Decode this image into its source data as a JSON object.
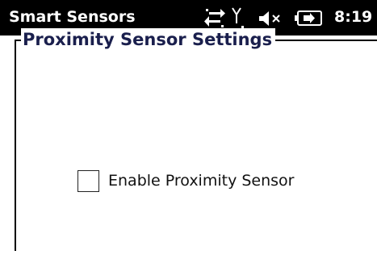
{
  "status_bar": {
    "app_title": "Smart Sensors",
    "time": "8:19",
    "icons": [
      "connectivity-arrows-icon",
      "signal-antenna-icon",
      "speaker-muted-icon",
      "battery-charging-icon"
    ]
  },
  "settings": {
    "group_title": "Proximity Sensor Settings",
    "enable_label": "Enable Proximity Sensor",
    "enable_checked": false
  },
  "colors": {
    "titlebar_bg": "#000000",
    "titlebar_text": "#ffffff",
    "group_title": "#1a1f4d",
    "background": "#ffffff"
  }
}
